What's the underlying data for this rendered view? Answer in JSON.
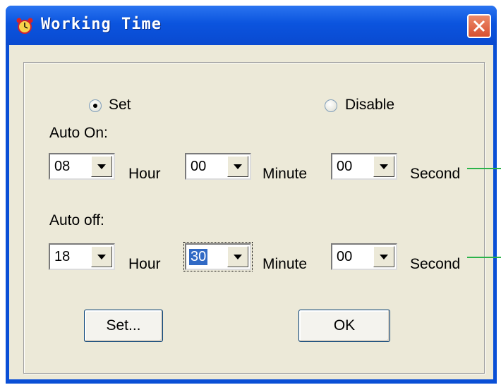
{
  "window": {
    "title": "Working Time",
    "close_icon": "close-icon",
    "app_icon": "alarm-clock-icon"
  },
  "mode": {
    "options": [
      {
        "label": "Set",
        "checked": true
      },
      {
        "label": "Disable",
        "checked": false
      }
    ]
  },
  "auto_on": {
    "label": "Auto On:",
    "hour": {
      "value": "08",
      "unit": "Hour"
    },
    "minute": {
      "value": "00",
      "unit": "Minute"
    },
    "second": {
      "value": "00",
      "unit": "Second"
    }
  },
  "auto_off": {
    "label": "Auto off:",
    "hour": {
      "value": "18",
      "unit": "Hour"
    },
    "minute": {
      "value": "30",
      "unit": "Minute"
    },
    "second": {
      "value": "00",
      "unit": "Second"
    }
  },
  "buttons": {
    "set": "Set...",
    "ok": "OK"
  },
  "colors": {
    "titlebar": "#0a54de",
    "client": "#ece9d8",
    "selection": "#316ac5",
    "pointer_line": "#2bb34a"
  }
}
